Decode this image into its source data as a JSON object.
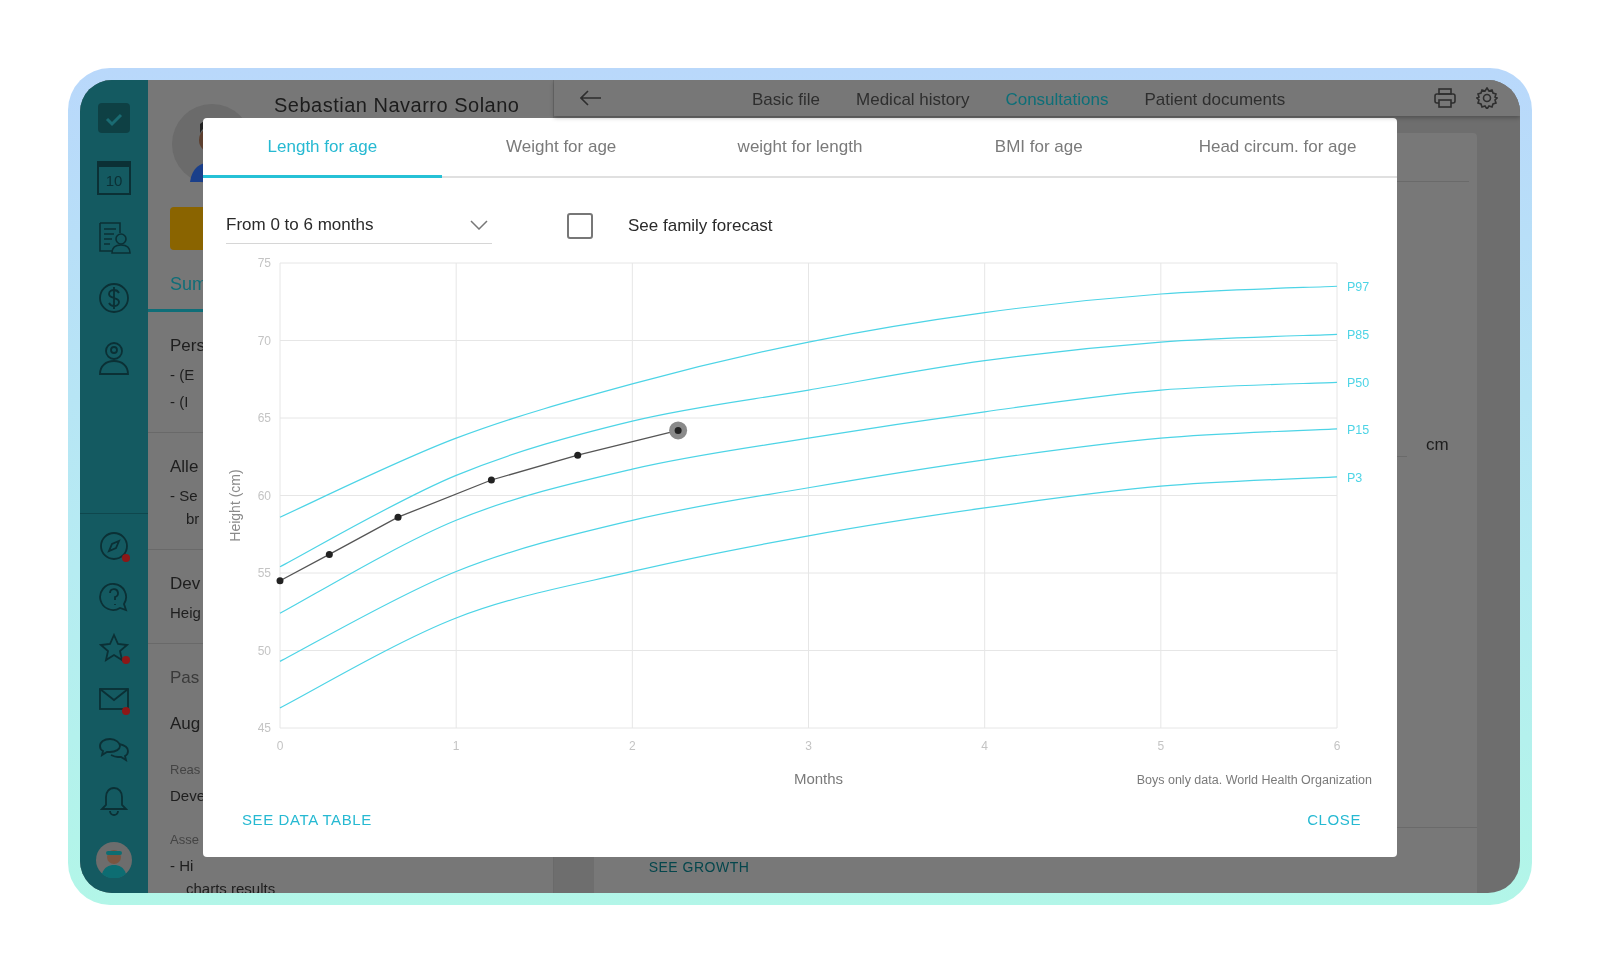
{
  "sidebar": {
    "top_items": [
      {
        "kind": "tasks",
        "alert": false
      },
      {
        "kind": "calendar",
        "label": "10",
        "alert": false
      },
      {
        "kind": "records",
        "alert": false
      },
      {
        "kind": "billing",
        "alert": false
      },
      {
        "kind": "doctor",
        "alert": false
      }
    ],
    "bottom_items": [
      {
        "kind": "compass",
        "alert": true
      },
      {
        "kind": "help",
        "alert": false
      },
      {
        "kind": "star",
        "alert": true
      },
      {
        "kind": "mail",
        "alert": true
      },
      {
        "kind": "chat",
        "alert": false
      },
      {
        "kind": "bell",
        "alert": false
      }
    ]
  },
  "patient": {
    "name": "Sebastian Navarro Solano"
  },
  "left_panel": {
    "tab": "Sum",
    "sections": [
      {
        "lines": [
          {
            "kind": "heading",
            "text": "Pers"
          },
          {
            "kind": "bullet",
            "text": "- (E"
          },
          {
            "kind": "bullet",
            "text": "- (I"
          }
        ]
      },
      {
        "lines": [
          {
            "kind": "heading",
            "text": "Alle"
          },
          {
            "kind": "bullet",
            "text": "- Se"
          },
          {
            "kind": "cont",
            "text": "br"
          }
        ]
      },
      {
        "lines": [
          {
            "kind": "heading",
            "text": "Dev"
          },
          {
            "kind": "text",
            "text": "Heig"
          }
        ]
      },
      {
        "lines": [
          {
            "kind": "subheading",
            "text": "Pas"
          },
          {
            "kind": "heading",
            "text": "Aug"
          },
          {
            "kind": "label",
            "text": "Reas"
          },
          {
            "kind": "text",
            "text": "Deve"
          },
          {
            "kind": "label",
            "text": "Asse"
          },
          {
            "kind": "bullet",
            "text": "- Hi"
          },
          {
            "kind": "cont",
            "text": "charts results"
          }
        ]
      }
    ]
  },
  "nav": {
    "tabs": [
      {
        "label": "Basic file",
        "selected": false
      },
      {
        "label": "Medical history",
        "selected": false
      },
      {
        "label": "Consultations",
        "selected": true
      },
      {
        "label": "Patient documents",
        "selected": false
      }
    ]
  },
  "card": {
    "unit": "cm",
    "button": "SEE GROWTH"
  },
  "modal": {
    "tabs": [
      {
        "label": "Length for age",
        "selected": true
      },
      {
        "label": "Weight for age",
        "selected": false
      },
      {
        "label": "weight for length",
        "selected": false
      },
      {
        "label": "BMI for age",
        "selected": false
      },
      {
        "label": "Head circum. for age",
        "selected": false
      }
    ],
    "range_select": {
      "value": "From 0 to 6 months"
    },
    "family_forecast": {
      "label": "See family forecast",
      "checked": false
    },
    "chart_data": {
      "type": "line",
      "xlabel": "Months",
      "ylabel": "Height (cm)",
      "x": [
        0,
        1,
        2,
        3,
        4,
        5,
        6
      ],
      "xlim": [
        0,
        6
      ],
      "ylim": [
        45,
        75
      ],
      "grid": true,
      "xticks": [
        0,
        1,
        2,
        3,
        4,
        5,
        6
      ],
      "yticks": [
        45,
        50,
        55,
        60,
        65,
        70,
        75
      ],
      "series": [
        {
          "name": "P97",
          "color": "#4dd4e6",
          "values": [
            58.6,
            63.7,
            67.2,
            69.9,
            71.8,
            73.0,
            73.5
          ]
        },
        {
          "name": "P85",
          "color": "#4dd4e6",
          "values": [
            55.4,
            61.3,
            64.8,
            66.8,
            68.7,
            69.9,
            70.4
          ]
        },
        {
          "name": "P50",
          "color": "#4dd4e6",
          "values": [
            52.4,
            58.4,
            61.7,
            63.7,
            65.4,
            66.8,
            67.3
          ]
        },
        {
          "name": "P15",
          "color": "#4dd4e6",
          "values": [
            49.3,
            55.1,
            58.4,
            60.5,
            62.3,
            63.7,
            64.3
          ]
        },
        {
          "name": "P3",
          "color": "#4dd4e6",
          "values": [
            46.3,
            52.1,
            55.1,
            57.4,
            59.2,
            60.6,
            61.2
          ]
        },
        {
          "color": "#555555",
          "x": [
            0,
            0.28,
            0.67,
            1.2,
            1.69,
            2.26
          ],
          "values": [
            54.5,
            56.2,
            58.6,
            61.0,
            62.6,
            64.2
          ],
          "marker": "o"
        }
      ]
    },
    "note": "Boys only data. World Health Organization",
    "actions": [
      "SEE DATA TABLE",
      "CLOSE"
    ]
  }
}
